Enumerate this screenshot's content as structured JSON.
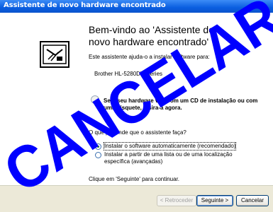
{
  "window": {
    "title": "Assistente de novo hardware encontrado"
  },
  "heading": "Bem-vindo ao 'Assistente de novo hardware encontrado'",
  "intro": "Este assistente ajuda-o a instalar software para:",
  "device": "Brother HL-5280DW series",
  "cd_text": "Se o seu hardware vier com um CD de instalação ou com uma disquete, insira-a agora.",
  "question": "O que pretende que o assistente faça?",
  "options": [
    {
      "label": "Instalar o software automaticamente (recomendado)",
      "selected": true
    },
    {
      "label": "Instalar a partir de uma lista ou de uma localização específica (avançadas)",
      "selected": false
    }
  ],
  "continue_text": "Clique em 'Seguinte' para continuar.",
  "buttons": {
    "back": "< Retroceder",
    "next": "Seguinte >",
    "cancel": "Cancelar"
  },
  "stamp": {
    "text": "CANCELAR",
    "color": "#0000ff"
  }
}
